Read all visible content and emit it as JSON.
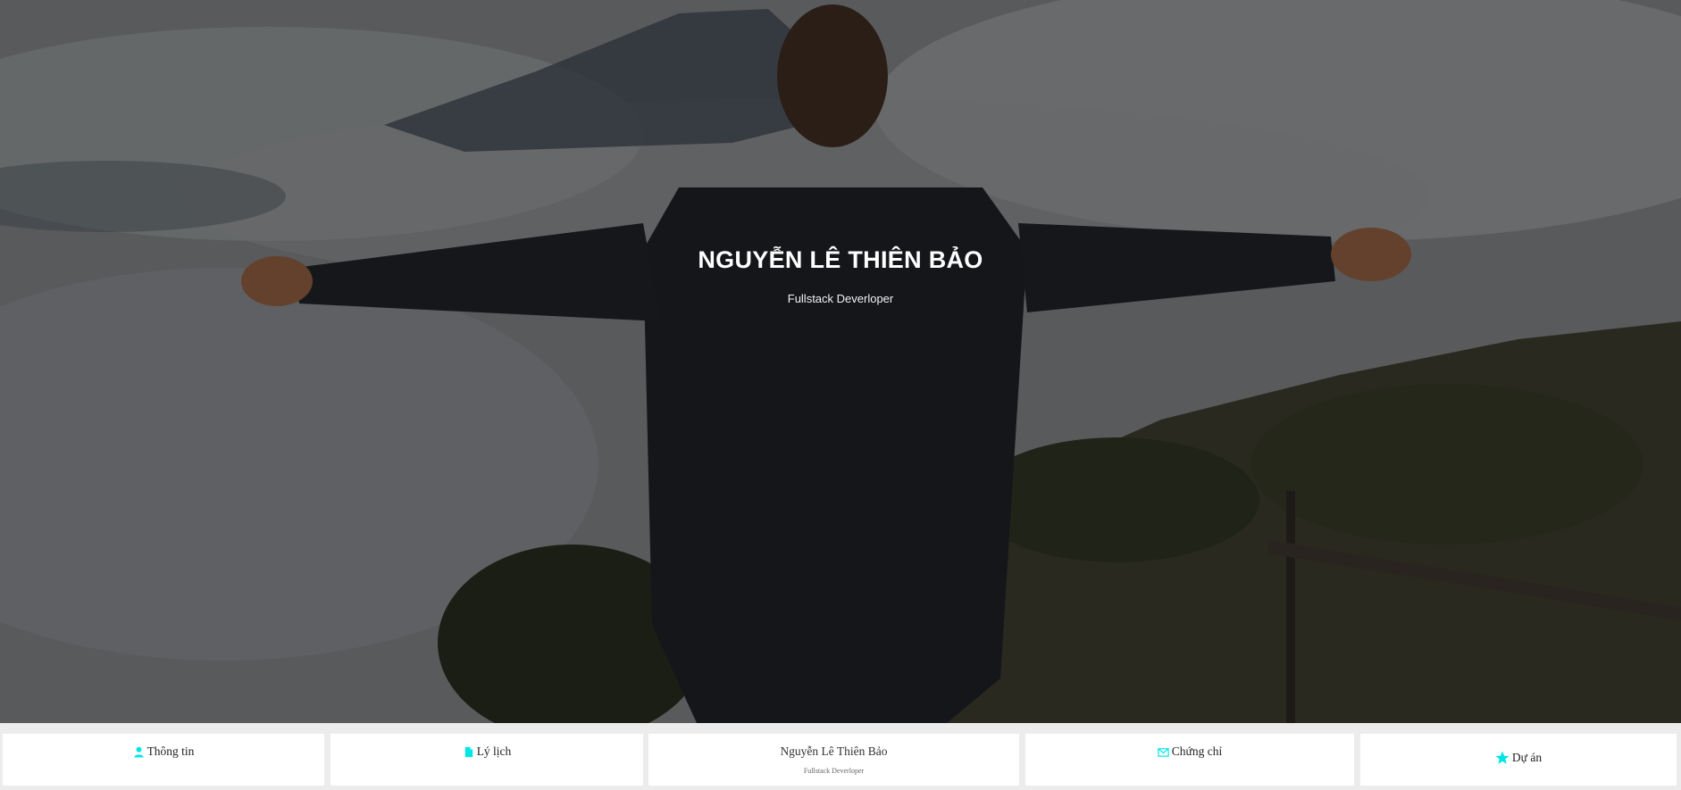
{
  "hero": {
    "title": "NGUYỄN LÊ THIÊN BẢO",
    "subtitle": "Fullstack Deverloper"
  },
  "nav": {
    "items": [
      {
        "label": "Thông tin",
        "icon": "user-icon"
      },
      {
        "label": "Lý lịch",
        "icon": "file-icon"
      },
      {
        "label": "Chứng chỉ",
        "icon": "envelope-icon"
      },
      {
        "label": "Dự án",
        "icon": "star-icon"
      }
    ],
    "center": {
      "name": "Nguyễn Lê Thiên Bảo",
      "subtitle": "Fullstack Deverloper"
    }
  },
  "colors": {
    "accent": "#00e5e5",
    "overlay": "#000000",
    "navbar_bg": "#ececec",
    "card_bg": "#ffffff"
  }
}
